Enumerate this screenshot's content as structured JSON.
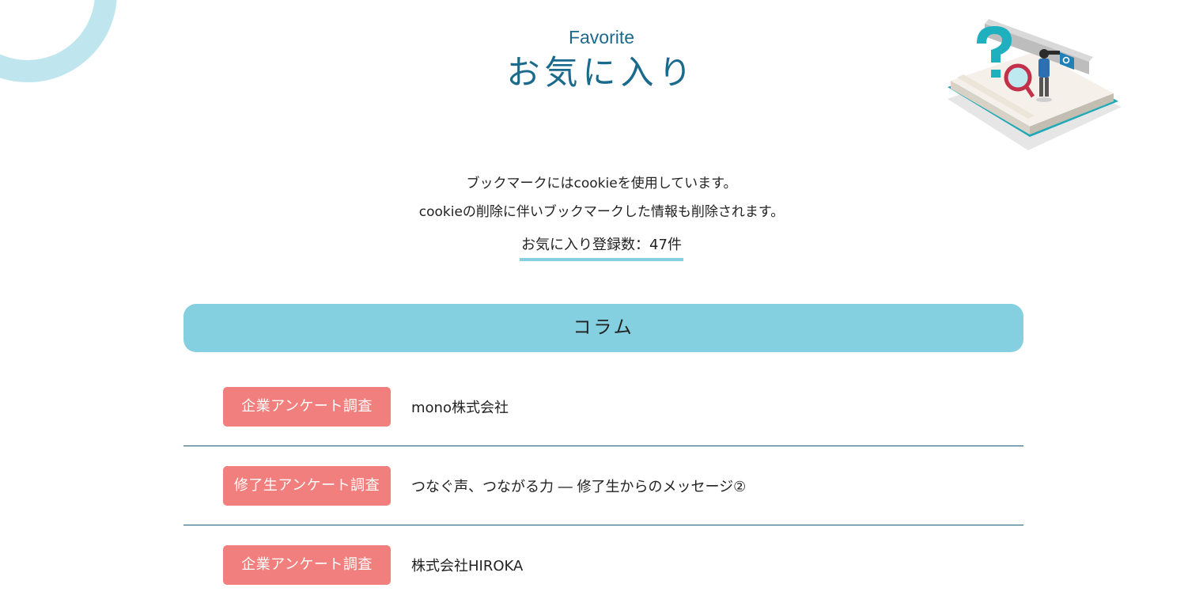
{
  "header": {
    "title_en": "Favorite",
    "title_jp": "お気に入り"
  },
  "notice": {
    "line1": "ブックマークにはcookieを使用しています。",
    "line2": "cookieの削除に伴いブックマークした情報も削除されます。"
  },
  "favorites_count": "お気に入り登録数：47件",
  "section": {
    "label": "コラム"
  },
  "items": [
    {
      "tag": "企業アンケート調査",
      "title": "mono株式会社"
    },
    {
      "tag": "修了生アンケート調査",
      "title": "つなぐ声、つながる力 ― 修了生からのメッセージ②"
    },
    {
      "tag": "企業アンケート調査",
      "title": "株式会社HIROKA"
    }
  ],
  "icons": {
    "decoration": "ring-decoration",
    "illustration": "search-book-illustration"
  },
  "colors": {
    "accent_blue": "#1a6a8d",
    "section_bar": "#84cfe0",
    "tag_background": "#f07f7d",
    "divider": "#1a5b74",
    "ring": "#bfe6ee"
  }
}
